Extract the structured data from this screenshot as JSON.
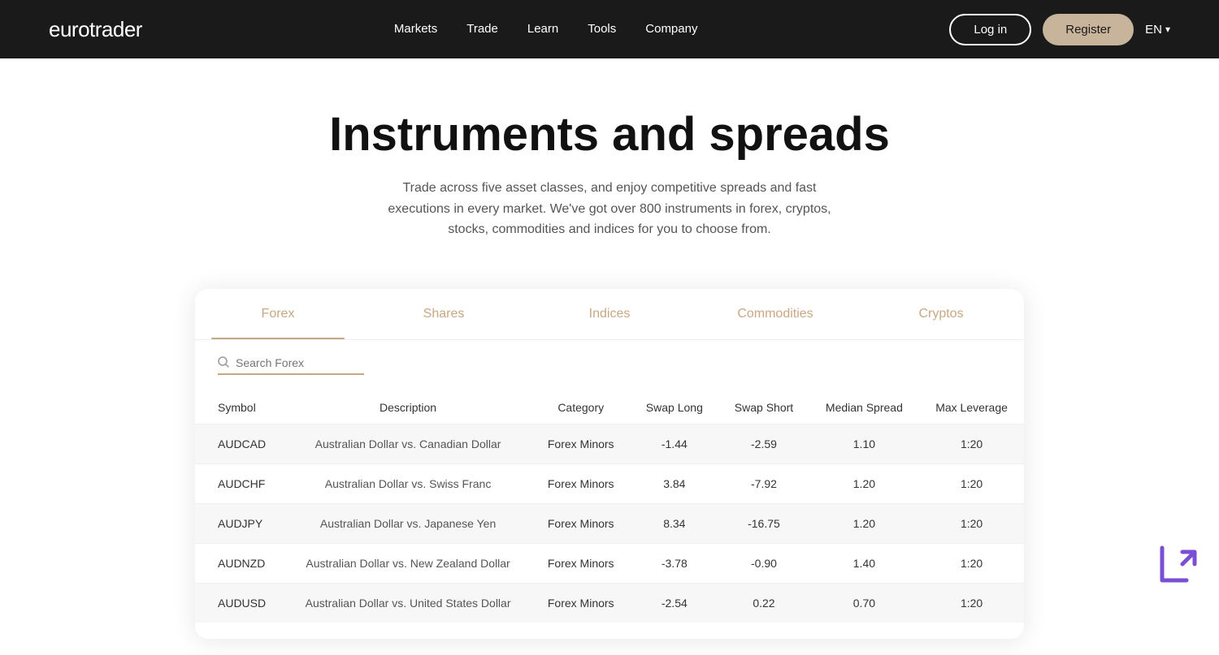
{
  "navbar": {
    "logo": "eurotrader",
    "nav_items": [
      "Markets",
      "Trade",
      "Learn",
      "Tools",
      "Company"
    ],
    "login_label": "Log in",
    "register_label": "Register",
    "lang": "EN"
  },
  "hero": {
    "title": "Instruments and spreads",
    "subtitle": "Trade across five asset classes, and enjoy competitive spreads and fast executions in every market. We've got over 800 instruments in forex, cryptos, stocks, commodities and indices for you to choose from."
  },
  "tabs": [
    {
      "id": "forex",
      "label": "Forex",
      "active": true
    },
    {
      "id": "shares",
      "label": "Shares",
      "active": false
    },
    {
      "id": "indices",
      "label": "Indices",
      "active": false
    },
    {
      "id": "commodities",
      "label": "Commodities",
      "active": false
    },
    {
      "id": "cryptos",
      "label": "Cryptos",
      "active": false
    }
  ],
  "search": {
    "placeholder": "Search Forex"
  },
  "table": {
    "columns": [
      "Symbol",
      "Description",
      "Category",
      "Swap Long",
      "Swap Short",
      "Median Spread",
      "Max Leverage"
    ],
    "rows": [
      {
        "symbol": "AUDCAD",
        "description": "Australian Dollar vs. Canadian Dollar",
        "category": "Forex Minors",
        "swap_long": "-1.44",
        "swap_short": "-2.59",
        "median_spread": "1.10",
        "max_leverage": "1:20"
      },
      {
        "symbol": "AUDCHF",
        "description": "Australian Dollar vs. Swiss Franc",
        "category": "Forex Minors",
        "swap_long": "3.84",
        "swap_short": "-7.92",
        "median_spread": "1.20",
        "max_leverage": "1:20"
      },
      {
        "symbol": "AUDJPY",
        "description": "Australian Dollar vs. Japanese Yen",
        "category": "Forex Minors",
        "swap_long": "8.34",
        "swap_short": "-16.75",
        "median_spread": "1.20",
        "max_leverage": "1:20"
      },
      {
        "symbol": "AUDNZD",
        "description": "Australian Dollar vs. New Zealand Dollar",
        "category": "Forex Minors",
        "swap_long": "-3.78",
        "swap_short": "-0.90",
        "median_spread": "1.40",
        "max_leverage": "1:20"
      },
      {
        "symbol": "AUDUSD",
        "description": "Australian Dollar vs. United States Dollar",
        "category": "Forex Minors",
        "swap_long": "-2.54",
        "swap_short": "0.22",
        "median_spread": "0.70",
        "max_leverage": "1:20"
      }
    ]
  }
}
